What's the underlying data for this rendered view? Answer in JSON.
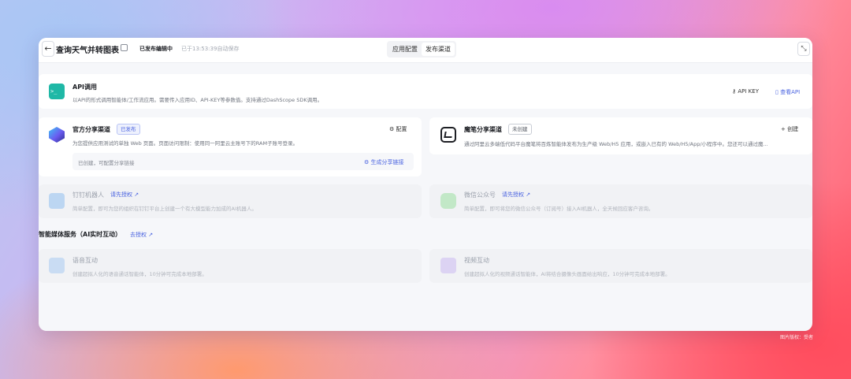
{
  "topbar": {
    "back_icon": "←",
    "title": "查询天气并转图表",
    "status": "已发布编辑中",
    "autosave": "已于13:53:39自动保存",
    "tabs": [
      {
        "label": "应用配置",
        "active": true
      },
      {
        "label": "发布渠道",
        "active": false
      }
    ],
    "collapse_icon": "⤡"
  },
  "api_card": {
    "icon": "terminal-icon",
    "icon_glyph": ">_",
    "title": "API调用",
    "desc": "以API的形式调用智能体/工作流应用。需要传入应用ID、API-KEY等参数值。支持通过DashScope SDK调用。",
    "api_key_label": "API KEY",
    "view_api_label": "查看API"
  },
  "official_card": {
    "title": "官方分享渠道",
    "badge": "已发布",
    "config_label": "配置",
    "desc": "为您提供应用测试的单独 Web 页面。页面访问限制：使用同一阿里云主账号下的RAM子账号登录。",
    "inner_text": "已创建，可配置分享链接",
    "generate_label": "生成分享链接"
  },
  "mobi_card": {
    "title": "魔笔分享渠道",
    "badge": "未创建",
    "create_label": "创建",
    "create_glyph": "+",
    "desc": "通过阿里云多端低代码平台魔笔将百炼智能体发布为生产级 Web/H5 应用，或嵌入已有的 Web/H5/App/小程序中。您还可以通过魔..."
  },
  "dingtalk_card": {
    "title": "钉钉机器人",
    "auth_label": "请先授权 ↗",
    "desc": "简单配置，即可为您的组织在钉钉平台上创建一个有大模型能力加成的AI机器人。"
  },
  "wechat_card": {
    "title": "微信公众号",
    "auth_label": "请先授权 ↗",
    "desc": "简单配置，即可将您的微信公众号（订阅号）接入AI机器人，全天候回应客户咨询。"
  },
  "media_section": {
    "title": "智能媒体服务（AI实时互动）",
    "auth_label": "去授权 ↗"
  },
  "voice_card": {
    "title": "语音互动",
    "desc": "创建超拟人化的语音通话智能体，10分钟可完成本地部署。"
  },
  "video_card": {
    "title": "视频互动",
    "desc": "创建超拟人化的视频通话智能体，AI将结合摄像头画面给出响应，10分钟可完成本地部署。"
  },
  "watermark": "图片版权：受者",
  "colors": {
    "accent": "#4a63e0",
    "api_icon": "#1fb8a6"
  }
}
